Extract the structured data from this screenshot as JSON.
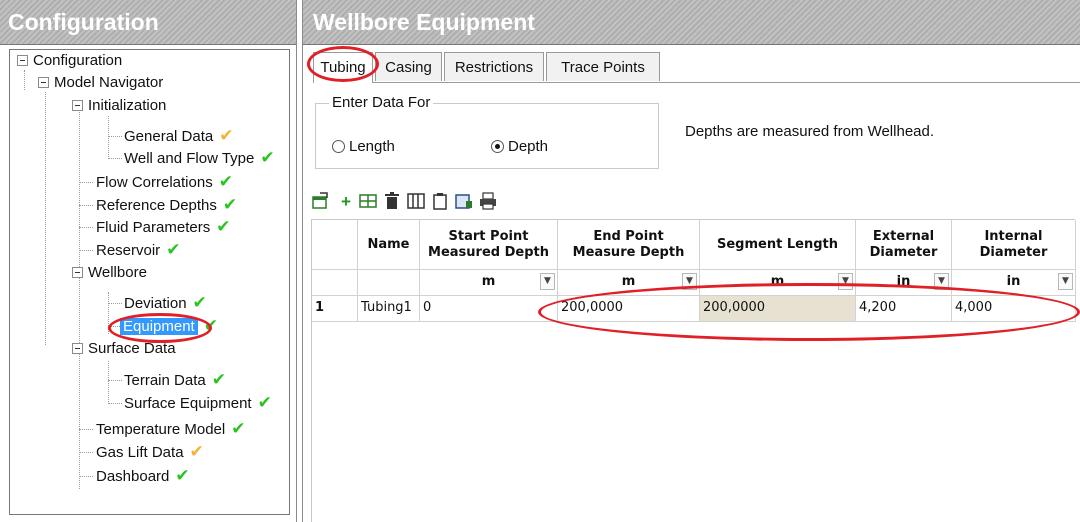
{
  "left_panel": {
    "header": "Configuration",
    "tree": {
      "root": "Configuration",
      "model_navigator": "Model Navigator",
      "initialization": "Initialization",
      "general_data": "General Data",
      "well_and_flow_type": "Well and Flow Type",
      "flow_correlations": "Flow Correlations",
      "reference_depths": "Reference Depths",
      "fluid_parameters": "Fluid Parameters",
      "reservoir": "Reservoir",
      "wellbore": "Wellbore",
      "deviation": "Deviation",
      "equipment": "Equipment",
      "surface_data": "Surface Data",
      "terrain_data": "Terrain Data",
      "surface_equipment": "Surface Equipment",
      "temperature_model": "Temperature Model",
      "gas_lift_data": "Gas Lift Data",
      "dashboard": "Dashboard"
    },
    "status_icons": {
      "done": "✔",
      "warn": "✔"
    },
    "colors": {
      "done": "#29c41d",
      "warn": "#f2b233",
      "selected": "#3399ff",
      "highlight": "#e01f26"
    }
  },
  "right_panel": {
    "header": "Wellbore Equipment",
    "tabs": [
      "Tubing",
      "Casing",
      "Restrictions",
      "Trace Points"
    ],
    "enter_data": {
      "title": "Enter Data For",
      "length_label": "Length",
      "depth_label": "Depth",
      "selected": "Depth"
    },
    "depth_note": "Depths are measured from Wellhead.",
    "toolbar_icons": [
      "import-icon",
      "add-icon",
      "insert-row-icon",
      "delete-icon",
      "columns-icon",
      "clipboard-icon",
      "export-icon",
      "print-icon"
    ],
    "grid": {
      "headers": [
        "Name",
        "Start Point Measured Depth",
        "End Point Measure Depth",
        "Segment Length",
        "External Diameter",
        "Internal Diameter"
      ],
      "header_lines": {
        "start": [
          "Start Point",
          "Measured Depth"
        ],
        "end": [
          "End Point",
          "Measure Depth"
        ],
        "ext": [
          "External",
          "Diameter"
        ],
        "int": [
          "Internal",
          "Diameter"
        ]
      },
      "units": {
        "start": "m",
        "end": "m",
        "segment": "m",
        "ext": "in",
        "int": "in"
      },
      "rows": [
        {
          "index": "1",
          "name": "Tubing1",
          "start": "0",
          "end": "200,0000",
          "segment": "200,0000",
          "ext": "4,200",
          "int": "4,000"
        }
      ]
    }
  }
}
